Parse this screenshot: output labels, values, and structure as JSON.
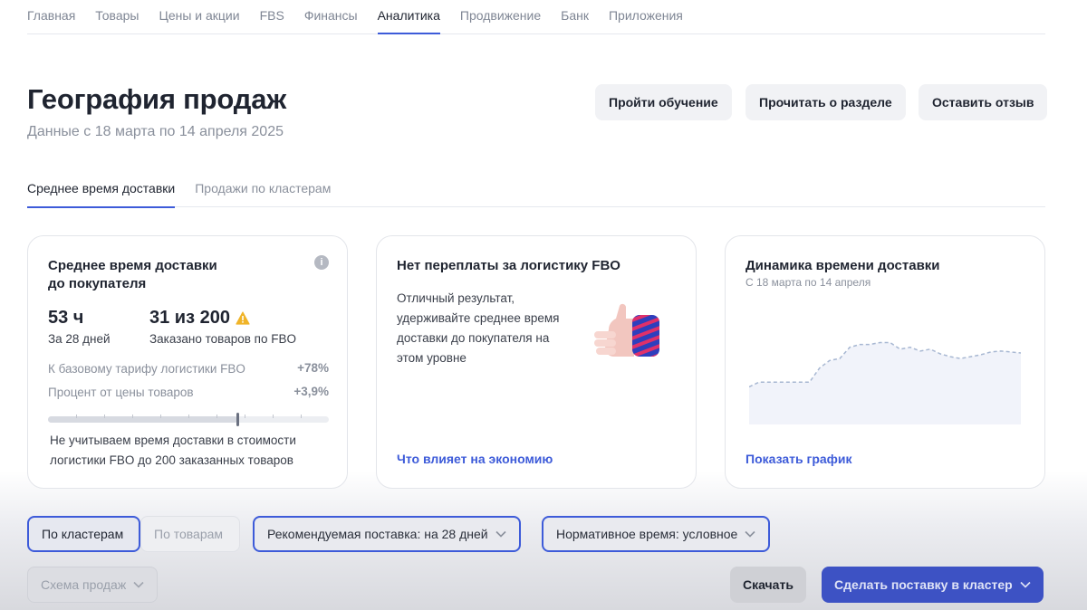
{
  "nav": {
    "items": [
      "Главная",
      "Товары",
      "Цены и акции",
      "FBS",
      "Финансы",
      "Аналитика",
      "Продвижение",
      "Банк",
      "Приложения"
    ],
    "active": "Аналитика"
  },
  "header": {
    "title": "География продаж",
    "subtitle": "Данные с 18 марта по 14 апреля 2025",
    "buttons": {
      "training": "Пройти обучение",
      "read": "Прочитать о разделе",
      "feedback": "Оставить отзыв"
    }
  },
  "tabs": {
    "delivery": "Среднее время доставки",
    "clusters": "Продажи по кластерам"
  },
  "card1": {
    "title_line1": "Среднее время доставки",
    "title_line2": "до покупателя",
    "info_icon": "info-icon",
    "hours_value": "53 ч",
    "hours_label": "За 28 дней",
    "ordered_value": "31 из 200",
    "ordered_label": "Заказано товаров по FBO",
    "warning_icon": "warning-icon",
    "rows": [
      {
        "label": "К базовому тарифу логистики FBO",
        "value": "+78%"
      },
      {
        "label": "Процент от цены товаров",
        "value": "+3,9%"
      }
    ],
    "progress_fraction": 0.675,
    "note": "Не учитываем время доставки в стоимости логистики FBO до 200 заказанных товаров"
  },
  "card2": {
    "title": "Нет переплаты за логистику FBO",
    "text": "Отличный результат, удерживайте среднее время доставки до покупателя на этом уровне",
    "illustration": "thumbs-up-icon",
    "link": "Что влияет на экономию"
  },
  "card3": {
    "title": "Динамика времени доставки",
    "subtitle": "С 18 марта по 14 апреля",
    "link": "Показать график"
  },
  "chart_data": {
    "type": "area",
    "title": "Динамика времени доставки",
    "subtitle": "С 18 марта по 14 апреля",
    "xlabel": "",
    "ylabel": "",
    "grid": false,
    "legend": "none",
    "series": [
      {
        "values": [
          40,
          45,
          45,
          45,
          45,
          45,
          45,
          60,
          68,
          70,
          82,
          85,
          85,
          87,
          87,
          80,
          82,
          78,
          80,
          75,
          72,
          70,
          72,
          74,
          77,
          78,
          77,
          76
        ]
      }
    ],
    "ylim": [
      0,
      100
    ],
    "colors": {
      "fill": "#f1f3fa",
      "line": "#a7b7d2"
    }
  },
  "controls": {
    "by_clusters": "По кластерам",
    "by_products": "По товарам",
    "recommended": "Рекомендуемая поставка: на 28 дней",
    "normative": "Нормативное время: условное",
    "scheme": "Схема продаж",
    "download": "Скачать",
    "make_supply": "Сделать поставку в кластер"
  },
  "colors": {
    "accent": "#3d5bd9",
    "primary_button": "#3d52c4",
    "warning": "#f0b429"
  }
}
